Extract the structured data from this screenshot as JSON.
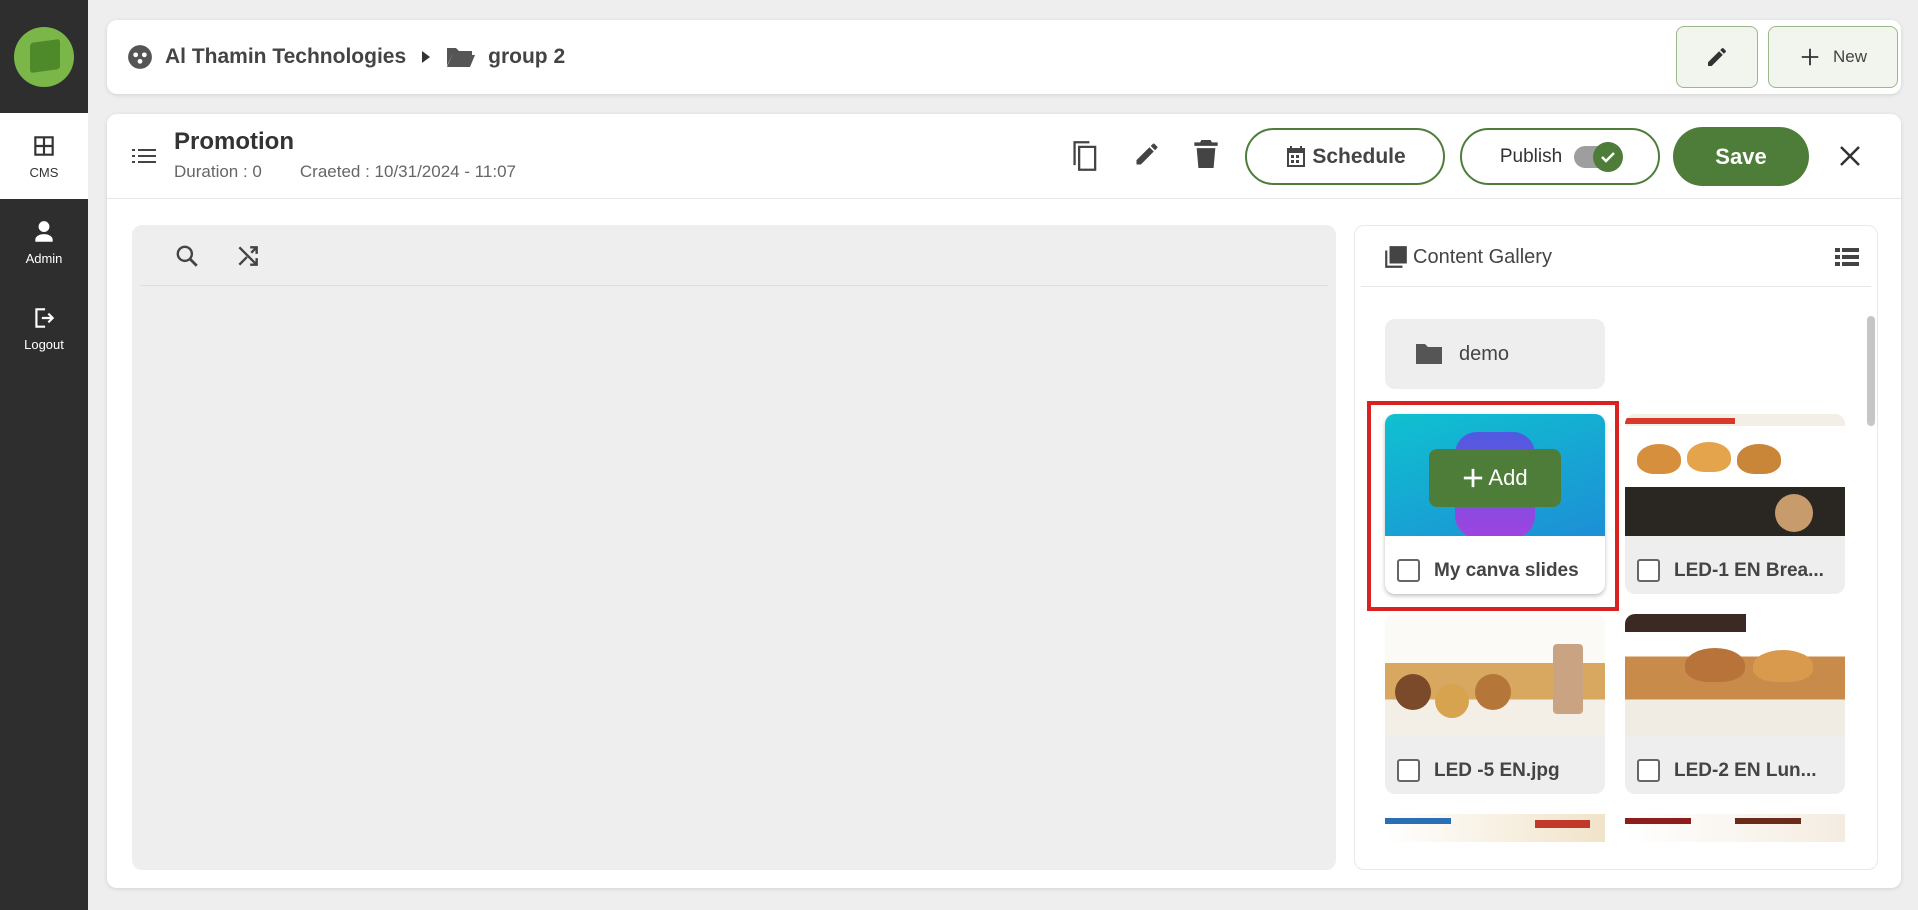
{
  "sidebar": {
    "items": [
      {
        "label": "CMS",
        "icon": "grid-icon"
      },
      {
        "label": "Admin",
        "icon": "person-icon"
      },
      {
        "label": "Logout",
        "icon": "logout-icon"
      }
    ]
  },
  "topbar": {
    "org": "Al Thamin Technologies",
    "group": "group 2",
    "new_label": "New"
  },
  "playlist": {
    "title": "Promotion",
    "duration": "Duration : 0",
    "created": "Craeted : 10/31/2024 - 11:07",
    "schedule_label": "Schedule",
    "publish_label": "Publish",
    "save_label": "Save"
  },
  "gallery": {
    "title": "Content Gallery",
    "folder": "demo",
    "add_label": "Add",
    "items": [
      {
        "name": "My canva slides"
      },
      {
        "name": "LED-1 EN Brea..."
      },
      {
        "name": "LED -5 EN.jpg"
      },
      {
        "name": "LED-2 EN Lun..."
      }
    ]
  },
  "colors": {
    "accent": "#4e7d3a",
    "highlight": "#d9221f",
    "sidebar": "#2e2e2e"
  }
}
